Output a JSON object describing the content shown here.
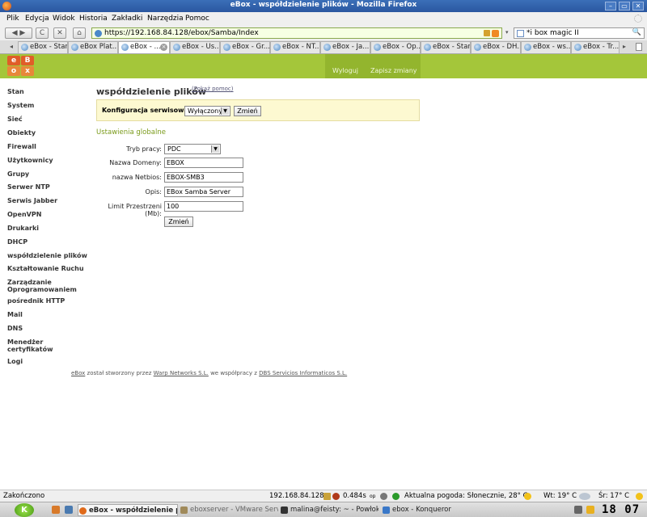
{
  "window": {
    "title": "eBox - współdzielenie plików - Mozilla Firefox",
    "btn_min": "–",
    "btn_max": "▭",
    "btn_close": "✕"
  },
  "menu": [
    "Plik",
    "Edycja",
    "Widok",
    "Historia",
    "Zakładki",
    "Narzędzia",
    "Pomoc"
  ],
  "nav": {
    "back": "◀ ▶",
    "reload": "C",
    "stop": "✕",
    "home": "⌂",
    "url": "https://192.168.84.128/ebox/Samba/Index",
    "search_value": "*i box magic II",
    "search_glyph": "🔍"
  },
  "tabs": [
    "eBox - Stan",
    "eBox Plat...",
    "eBox - ...",
    "eBox - Us...",
    "eBox - Gr...",
    "eBox - NT...",
    "eBox - Ja...",
    "eBox - Op...",
    "eBox - Stan",
    "eBox - DH...",
    "eBox - ws...",
    "eBox - Tr..."
  ],
  "tab_close": "×",
  "tab_arrows": {
    "left": "◂",
    "right": "▸"
  },
  "ebox": {
    "logo_letters": [
      "e",
      "B",
      "o",
      "x"
    ],
    "logout": "Wyloguj",
    "save_changes": "Zapisz zmiany",
    "sidebar": [
      "Stan",
      "System",
      "Sieć",
      "Obiekty",
      "Firewall",
      "Użytkownicy",
      "Grupy",
      "Serwer NTP",
      "Serwis Jabber",
      "OpenVPN",
      "Drukarki",
      "DHCP",
      "współdzielenie plików",
      "Kształtowanie Ruchu",
      "Zarządzanie Oprogramowaniem",
      "pośrednik HTTP",
      "Mail",
      "DNS",
      "Menedżer certyfikatów",
      "Logi"
    ],
    "page_title": "współdzielenie plików",
    "help_link": "(Pokaż pomoc)",
    "service_label": "Konfiguracja serwisowa:",
    "service_value": "Wyłączony",
    "service_button": "Zmień",
    "section_title": "Ustawienia globalne",
    "form": {
      "mode_label": "Tryb pracy:",
      "mode_value": "PDC",
      "domain_label": "Nazwa Domeny:",
      "domain_value": "EBOX",
      "netbios_label": "nazwa Netbios:",
      "netbios_value": "EBOX-SMB3",
      "desc_label": "Opis:",
      "desc_value": "EBox Samba Server",
      "quota_label": "Limit Przestrzeni (Mb):",
      "quota_value": "100",
      "submit": "Zmień"
    },
    "select_arrow": "▼",
    "footer": {
      "ebox": "eBox",
      "t1": " został stworzony przez ",
      "warp": "Warp Networks S.L.",
      "t2": " we współpracy z ",
      "dbs": "DBS Servicios Informaticos S.L."
    }
  },
  "status": {
    "done": "Zakończono",
    "ip": "192.168.84.128",
    "time": "0.484s",
    "op": "op",
    "weather": "Aktualna pogoda: Słonecznie, 28° C",
    "wt": "Wt: 19° C",
    "sr": "Śr: 17° C"
  },
  "taskbar": {
    "kmenu": "K",
    "tasks": [
      "eBox - współdzielenie pli",
      "eboxserver - VMware Server",
      "malina@feisty: ~ - Powłoka",
      "ebox - Konqueror"
    ],
    "clock": "18 07"
  }
}
